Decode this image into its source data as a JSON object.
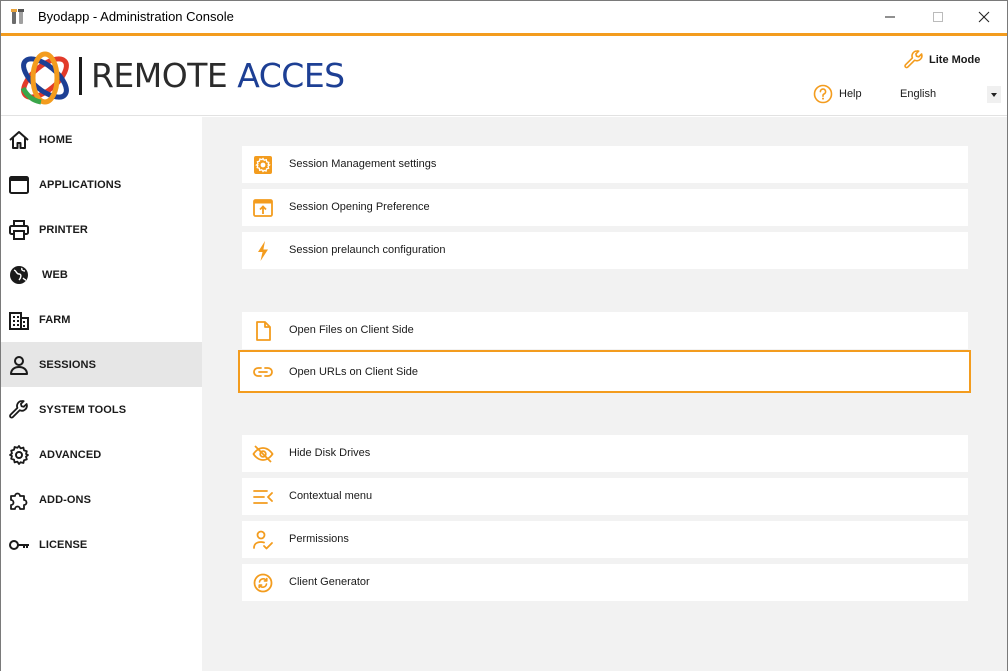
{
  "window": {
    "title": "Byodapp - Administration Console"
  },
  "header": {
    "logo_word_1": "REMOTE",
    "logo_word_2": "ACCES",
    "lite_mode_label": "Lite Mode",
    "help_label": "Help",
    "language": "English"
  },
  "colors": {
    "accent": "#f39c1e",
    "logo_blue": "#1d3f94",
    "selected_nav_bg": "#e6e6e6",
    "content_bg": "#f2f2f2"
  },
  "sidebar": {
    "items": [
      {
        "label": "HOME",
        "icon": "home-icon"
      },
      {
        "label": "APPLICATIONS",
        "icon": "window-icon"
      },
      {
        "label": "PRINTER",
        "icon": "printer-icon"
      },
      {
        "label": "WEB",
        "icon": "globe-icon"
      },
      {
        "label": "FARM",
        "icon": "building-icon"
      },
      {
        "label": "SESSIONS",
        "icon": "user-icon",
        "active": true
      },
      {
        "label": "SYSTEM TOOLS",
        "icon": "wrench-icon"
      },
      {
        "label": "ADVANCED",
        "icon": "gear-icon"
      },
      {
        "label": "ADD-ONS",
        "icon": "puzzle-icon"
      },
      {
        "label": "LICENSE",
        "icon": "key-icon"
      }
    ]
  },
  "main": {
    "settings": [
      {
        "label": "Session Management settings",
        "icon": "gear-box-icon"
      },
      {
        "label": "Session Opening Preference",
        "icon": "window-upload-icon"
      },
      {
        "label": "Session prelaunch configuration",
        "icon": "lightning-icon"
      },
      {
        "label": "Open Files on Client Side",
        "icon": "file-icon"
      },
      {
        "label": "Open URLs on Client Side",
        "icon": "link-icon",
        "selected": true
      },
      {
        "label": "Hide Disk Drives",
        "icon": "eye-slash-icon"
      },
      {
        "label": "Contextual menu",
        "icon": "menu-icon"
      },
      {
        "label": "Permissions",
        "icon": "user-check-icon"
      },
      {
        "label": "Client Generator",
        "icon": "refresh-icon"
      }
    ]
  }
}
